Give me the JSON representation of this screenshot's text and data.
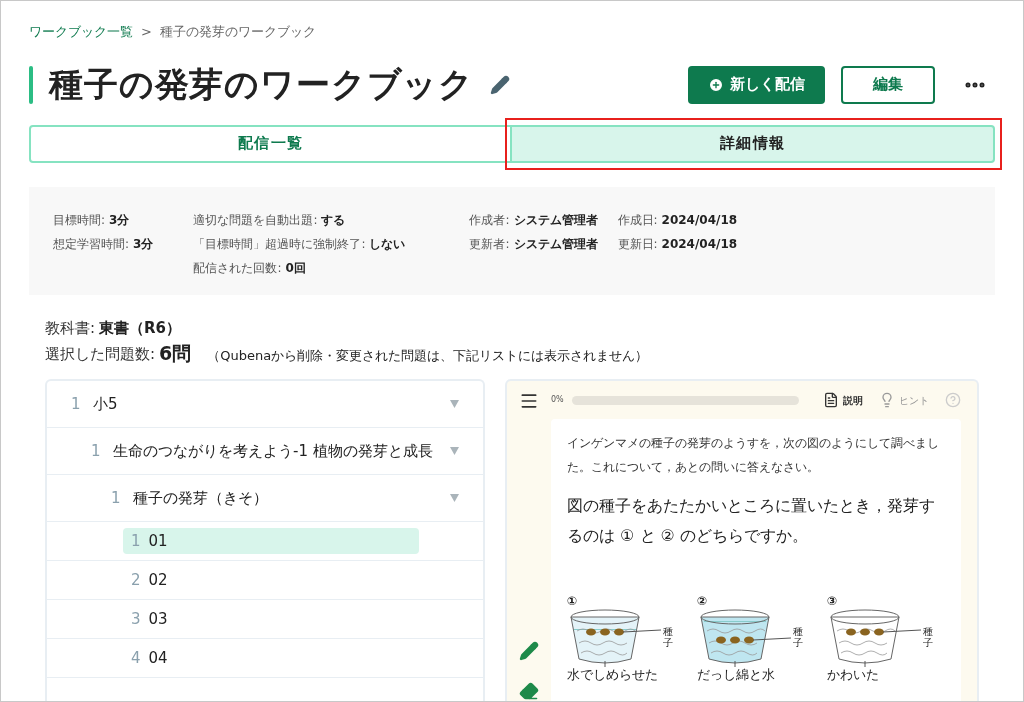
{
  "breadcrumb": [
    {
      "label": "ワークブック一覧",
      "kind": "link"
    },
    {
      "label": "種子の発芽のワークブック",
      "kind": "current"
    }
  ],
  "breadcrumb_separator": ">",
  "title": "種子の発芽のワークブック",
  "actions": {
    "new_distribution": "新しく配信",
    "edit": "編集"
  },
  "tabs": [
    {
      "label": "配信一覧",
      "selected": false
    },
    {
      "label": "詳細情報",
      "selected": true,
      "highlighted": true
    }
  ],
  "info_columns": [
    [
      {
        "label": "目標時間:",
        "value": "3分"
      },
      {
        "label": "想定学習時間:",
        "value": "3分"
      }
    ],
    [
      {
        "label": "適切な問題を自動出題:",
        "value": "する"
      },
      {
        "label": "「目標時間」超過時に強制終了:",
        "value": "しない"
      },
      {
        "label": "配信された回数:",
        "value": "0回"
      }
    ],
    [
      {
        "label": "作成者:",
        "value": "システム管理者"
      },
      {
        "label": "更新者:",
        "value": "システム管理者"
      }
    ],
    [
      {
        "label": "作成日:",
        "value": "2024/04/18"
      },
      {
        "label": "更新日:",
        "value": "2024/04/18"
      }
    ]
  ],
  "textbook": {
    "label": "教科書:",
    "value": "東書（R6）"
  },
  "problem_count": {
    "label": "選択した問題数:",
    "value": "6問",
    "note": "（Qubenaから削除・変更された問題は、下記リストには表示されません）"
  },
  "tree": [
    {
      "number": "1",
      "label": "小5",
      "expanded": true,
      "children": [
        {
          "number": "1",
          "label": "生命のつながりを考えよう-1 植物の発芽と成長",
          "expanded": true,
          "children": [
            {
              "number": "1",
              "label": "種子の発芽（きそ）",
              "expanded": true,
              "children": [
                {
                  "number": "1",
                  "label": "01",
                  "selected": true
                },
                {
                  "number": "2",
                  "label": "02",
                  "selected": false
                },
                {
                  "number": "3",
                  "label": "03",
                  "selected": false
                },
                {
                  "number": "4",
                  "label": "04",
                  "selected": false
                }
              ]
            }
          ]
        }
      ]
    }
  ],
  "preview": {
    "progress": {
      "reading": "0%",
      "level": 0
    },
    "tools": [
      {
        "label": "説明",
        "disabled": false
      },
      {
        "label": "ヒント",
        "disabled": true
      }
    ],
    "intro": "インゲンマメの種子の発芽のようすを，次の図のようにして調べました。これについて，あとの問いに答えなさい。",
    "question": "図の種子をあたたかいところに置いたとき，発芽するのは ① と ② のどちらですか。",
    "figure": [
      {
        "number": "①",
        "seed_label": "種子",
        "caption": "水でしめらせた",
        "kind": "moist"
      },
      {
        "number": "②",
        "seed_label": "種子",
        "caption": "だっし綿と水",
        "kind": "flooded"
      },
      {
        "number": "③",
        "seed_label": "種子",
        "caption": "かわいた",
        "kind": "dry"
      }
    ]
  }
}
